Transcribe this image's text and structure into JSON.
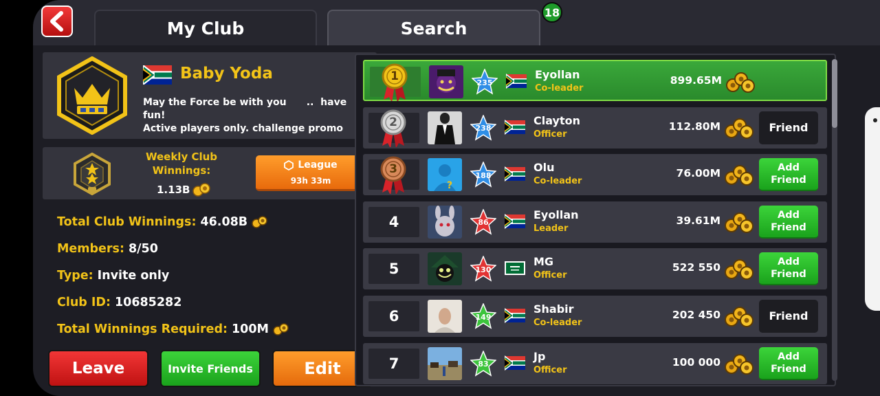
{
  "tabs": {
    "my_club": "My Club",
    "search": "Search",
    "search_badge": "18"
  },
  "club": {
    "name": "Baby Yoda",
    "description": "May the Force be with you      ..  have fun!\nActive players only. challenge promo",
    "flag": "south-africa-flag",
    "badge_icon": "crown-hexagon-icon"
  },
  "weekly": {
    "title": "Weekly Club Winnings:",
    "value": "1.13B",
    "league_label": "League",
    "league_time": "93h 33m"
  },
  "stats": [
    {
      "key": "Total Club Winnings:",
      "value": "46.08B",
      "coin": true
    },
    {
      "key": "Members:",
      "value": "8/50",
      "coin": false
    },
    {
      "key": "Type:",
      "value": "Invite only",
      "coin": false
    },
    {
      "key": "Club ID:",
      "value": "10685282",
      "coin": false
    },
    {
      "key": "Total Winnings Required:",
      "value": "100M",
      "coin": true
    }
  ],
  "buttons": {
    "leave": "Leave",
    "invite": "Invite Friends",
    "edit": "Edit"
  },
  "members": [
    {
      "rank": "1",
      "medal": "gold",
      "avatar": "villain",
      "level": "235",
      "level_color": "#2f8ee6",
      "flag": "za",
      "name": "Eyollan",
      "role": "Co-leader",
      "coins": "899.65M",
      "button": "",
      "highlight": true
    },
    {
      "rank": "2",
      "medal": "silver",
      "avatar": "suit",
      "level": "238",
      "level_color": "#2f8ee6",
      "flag": "za",
      "name": "Clayton",
      "role": "Officer",
      "coins": "112.80M",
      "button": "Friend",
      "highlight": false
    },
    {
      "rank": "3",
      "medal": "bronze",
      "avatar": "default",
      "level": "188",
      "level_color": "#2f8ee6",
      "flag": "za",
      "name": "Olu",
      "role": "Co-leader",
      "coins": "76.00M",
      "button": "Add\nFriend",
      "highlight": false
    },
    {
      "rank": "4",
      "medal": "",
      "avatar": "rabbit",
      "level": "86",
      "level_color": "#e23333",
      "flag": "za",
      "name": "Eyollan",
      "role": "Leader",
      "coins": "39.61M",
      "button": "Add\nFriend",
      "highlight": false
    },
    {
      "rank": "5",
      "medal": "",
      "avatar": "scarecrow",
      "level": "130",
      "level_color": "#e23333",
      "flag": "sa",
      "name": "MG",
      "role": "Officer",
      "coins": "522 550",
      "button": "Add\nFriend",
      "highlight": false
    },
    {
      "rank": "6",
      "medal": "",
      "avatar": "photo-man",
      "level": "149",
      "level_color": "#3cc43c",
      "flag": "za",
      "name": "Shabir",
      "role": "Co-leader",
      "coins": "202 450",
      "button": "Friend",
      "highlight": false
    },
    {
      "rank": "7",
      "medal": "",
      "avatar": "photo-outdoor",
      "level": "83",
      "level_color": "#3cc43c",
      "flag": "za",
      "name": "Jp",
      "role": "Officer",
      "coins": "100 000",
      "button": "Add\nFriend",
      "highlight": false
    }
  ]
}
